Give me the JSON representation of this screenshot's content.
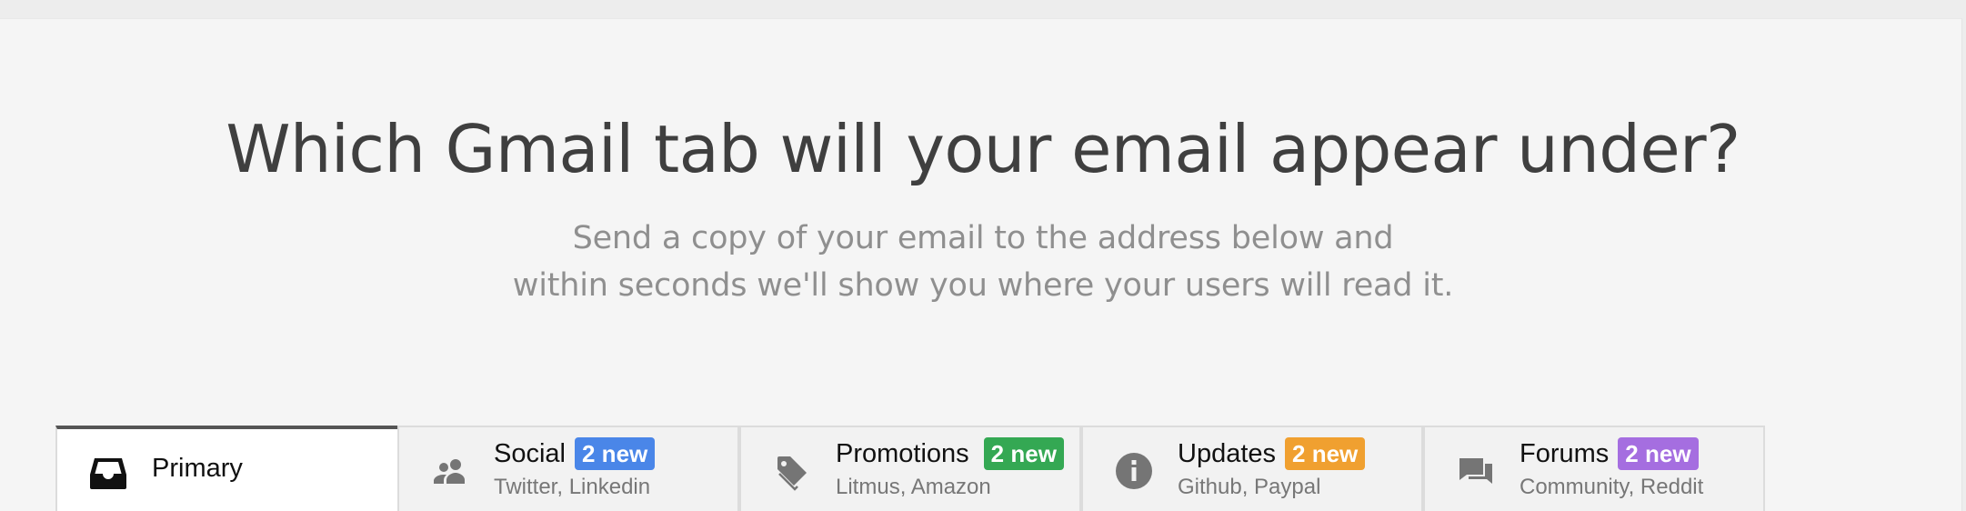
{
  "header": {
    "title": "Which Gmail tab will your email appear under?",
    "subtitle_line1": "Send a copy of your email to the address below and",
    "subtitle_line2": "within seconds we'll show you where your users will read it."
  },
  "tabs": [
    {
      "label": "Primary",
      "icon": "inbox-icon",
      "active": true
    },
    {
      "label": "Social",
      "badge": "2 new",
      "badge_color": "#4a86e8",
      "subtitle": "Twitter, Linkedin",
      "icon": "people-icon"
    },
    {
      "label": "Promotions",
      "badge": "2 new",
      "badge_color": "#34a853",
      "subtitle": "Litmus, Amazon",
      "icon": "tag-icon"
    },
    {
      "label": "Updates",
      "badge": "2 new",
      "badge_color": "#f0a030",
      "subtitle": "Github, Paypal",
      "icon": "info-icon"
    },
    {
      "label": "Forums",
      "badge": "2 new",
      "badge_color": "#a56ee0",
      "subtitle": "Community, Reddit",
      "icon": "forum-icon"
    }
  ],
  "colors": {
    "panel_bg": "#f5f5f5",
    "title": "#3f3f3f",
    "subtitle": "#8f8f8f"
  }
}
